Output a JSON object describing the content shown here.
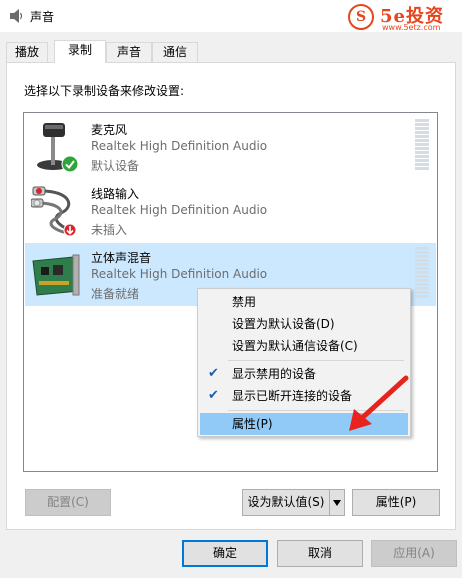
{
  "window": {
    "title": "声音",
    "icon": "speaker-icon"
  },
  "watermark": {
    "logo_char": "S",
    "brand": "5e投资",
    "url": "www.5etz.com"
  },
  "tabs": [
    {
      "label": "播放",
      "active": false
    },
    {
      "label": "录制",
      "active": true
    },
    {
      "label": "声音",
      "active": false
    },
    {
      "label": "通信",
      "active": false
    }
  ],
  "instruction": "选择以下录制设备来修改设置:",
  "devices": [
    {
      "name": "麦克风",
      "driver": "Realtek High Definition Audio",
      "status": "默认设备",
      "icon": "microphone-icon",
      "badge": "default-check-icon",
      "selected": false
    },
    {
      "name": "线路输入",
      "driver": "Realtek High Definition Audio",
      "status": "未插入",
      "icon": "line-in-cable-icon",
      "badge": "unplugged-icon",
      "selected": false
    },
    {
      "name": "立体声混音",
      "driver": "Realtek High Definition Audio",
      "status": "准备就绪",
      "icon": "sound-card-icon",
      "badge": "",
      "selected": true
    }
  ],
  "context_menu": {
    "items": [
      {
        "label": "禁用",
        "checked": false,
        "highlighted": false
      },
      {
        "label": "设置为默认设备(D)",
        "checked": false,
        "highlighted": false
      },
      {
        "label": "设置为默认通信设备(C)",
        "checked": false,
        "highlighted": false
      },
      {
        "label": "显示禁用的设备",
        "checked": true,
        "highlighted": false
      },
      {
        "label": "显示已断开连接的设备",
        "checked": true,
        "highlighted": false
      },
      {
        "label": "属性(P)",
        "checked": false,
        "highlighted": true
      }
    ]
  },
  "panel_buttons": {
    "configure": "配置(C)",
    "set_default": "设为默认值(S)",
    "properties": "属性(P)"
  },
  "dialog_buttons": {
    "ok": "确定",
    "cancel": "取消",
    "apply": "应用(A)"
  },
  "colors": {
    "selection": "#cce8ff",
    "menu_highlight": "#91c9f7",
    "accent": "#0078d7",
    "annotation_arrow": "#e8231e",
    "watermark": "#e6451e"
  }
}
